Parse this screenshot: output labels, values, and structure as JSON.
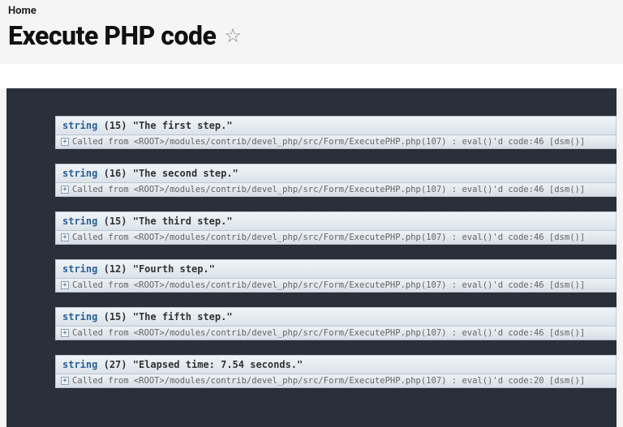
{
  "breadcrumb": "Home",
  "page_title": "Execute PHP code",
  "star_glyph": "☆",
  "expand_glyph": "+",
  "trace_prefix": "Called from ",
  "dumps": [
    {
      "type": "string",
      "len": "(15)",
      "value": "\"The first step.\"",
      "trace": "<ROOT>/modules/contrib/devel_php/src/Form/ExecutePHP.php(107) : eval()'d code:46 [dsm()]"
    },
    {
      "type": "string",
      "len": "(16)",
      "value": "\"The second step.\"",
      "trace": "<ROOT>/modules/contrib/devel_php/src/Form/ExecutePHP.php(107) : eval()'d code:46 [dsm()]"
    },
    {
      "type": "string",
      "len": "(15)",
      "value": "\"The third step.\"",
      "trace": "<ROOT>/modules/contrib/devel_php/src/Form/ExecutePHP.php(107) : eval()'d code:46 [dsm()]"
    },
    {
      "type": "string",
      "len": "(12)",
      "value": "\"Fourth step.\"",
      "trace": "<ROOT>/modules/contrib/devel_php/src/Form/ExecutePHP.php(107) : eval()'d code:46 [dsm()]"
    },
    {
      "type": "string",
      "len": "(15)",
      "value": "\"The fifth step.\"",
      "trace": "<ROOT>/modules/contrib/devel_php/src/Form/ExecutePHP.php(107) : eval()'d code:46 [dsm()]"
    },
    {
      "type": "string",
      "len": "(27)",
      "value": "\"Elapsed time: 7.54 seconds.\"",
      "trace": "<ROOT>/modules/contrib/devel_php/src/Form/ExecutePHP.php(107) : eval()'d code:20 [dsm()]"
    }
  ]
}
